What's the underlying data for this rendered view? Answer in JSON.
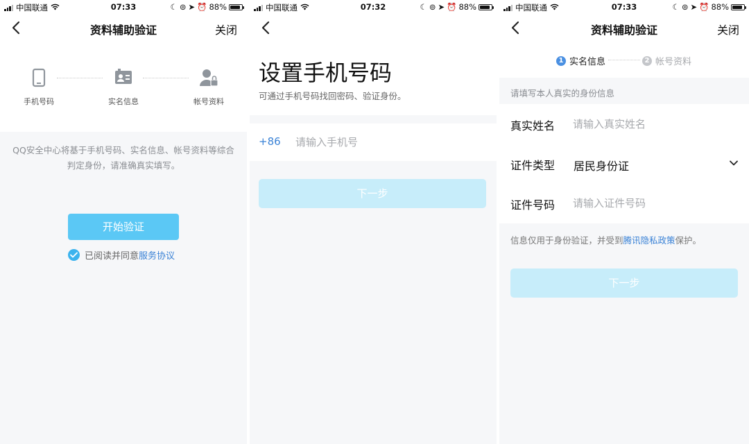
{
  "statusbar": {
    "panel1": {
      "carrier": "中国联通",
      "time": "07:33",
      "battery": "88%"
    },
    "panel2": {
      "carrier": "中国联通",
      "time": "07:32",
      "battery": "88%"
    },
    "panel3": {
      "carrier": "中国联通",
      "time": "07:33",
      "battery": "88%"
    }
  },
  "panel1": {
    "title": "资料辅助验证",
    "close": "关闭",
    "steps": [
      {
        "label": "手机号码",
        "icon": "phone-icon"
      },
      {
        "label": "实名信息",
        "icon": "id-card-icon"
      },
      {
        "label": "帐号资料",
        "icon": "user-lock-icon"
      }
    ],
    "description": "QQ安全中心将基于手机号码、实名信息、帐号资料等综合判定身份，请准确真实填写。",
    "start_button": "开始验证",
    "agree_text": "已阅读并同意",
    "agree_link": "服务协议"
  },
  "panel2": {
    "heading": "设置手机号码",
    "subtitle": "可通过手机号码找回密码、验证身份。",
    "country_code": "+86",
    "phone_placeholder": "请输入手机号",
    "next_button": "下一步"
  },
  "panel3": {
    "title": "资料辅助验证",
    "close": "关闭",
    "step1_num": "1",
    "step1_label": "实名信息",
    "step2_num": "2",
    "step2_label": "帐号资料",
    "hint": "请填写本人真实的身份信息",
    "name_label": "真实姓名",
    "name_placeholder": "请输入真实姓名",
    "id_type_label": "证件类型",
    "id_type_value": "居民身份证",
    "id_number_label": "证件号码",
    "id_number_placeholder": "请输入证件号码",
    "note_prefix": "信息仅用于身份验证，并受到",
    "note_link": "腾讯隐私政策",
    "note_suffix": "保护。",
    "next_button": "下一步"
  },
  "colors": {
    "accent": "#3a82d6",
    "button_active": "#5bc8f5",
    "button_disabled": "#c7edfa",
    "step_active": "#4a90e2",
    "step_inactive": "#c4c6ca"
  }
}
